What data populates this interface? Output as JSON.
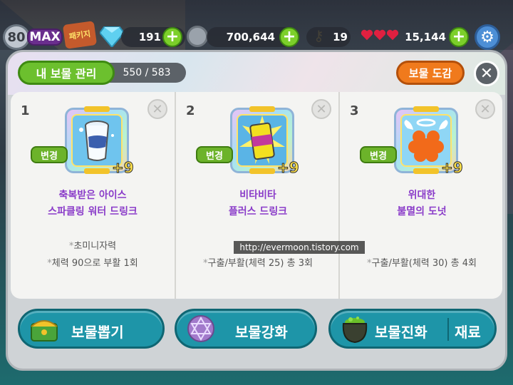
{
  "top_bar": {
    "level": "80",
    "max_label": "MAX",
    "event_label": "패키지",
    "gems": "191",
    "coins": "700,644",
    "keys": "19",
    "hearts": "15,144"
  },
  "panel": {
    "tab_label": "내 보물 관리",
    "count": "550 / 583",
    "dex_button": "보물 도감"
  },
  "slots": [
    {
      "number": "1",
      "change_label": "변경",
      "enhance": "+9",
      "name_line1": "축복받은 아이스",
      "name_line2": "스파클링 워터 드링크",
      "desc_line1": "초미니자력",
      "desc_line2": "체력 90으로 부활 1회",
      "icon": "ice-sparkling-water-can-icon"
    },
    {
      "number": "2",
      "change_label": "변경",
      "enhance": "+9",
      "name_line1": "비타비타",
      "name_line2": "플러스 드링크",
      "desc_line1": "",
      "desc_line2": "구출/부활(체력 25) 총 3회",
      "icon": "vita-plus-drink-can-icon"
    },
    {
      "number": "3",
      "change_label": "변경",
      "enhance": "+9",
      "name_line1": "위대한",
      "name_line2": "불멸의 도넛",
      "desc_line1": "",
      "desc_line2": "구출/부활(체력 30) 총 4회",
      "icon": "immortal-donut-icon"
    }
  ],
  "bottom": {
    "draw_label": "보물뽑기",
    "enhance_label": "보물강화",
    "evolve_label": "보물진화",
    "material_label": "재료"
  },
  "watermark": "http://evermoon.tistory.com",
  "colors": {
    "accent_green": "#6cc02e",
    "accent_orange": "#f07a1c",
    "item_name_purple": "#8a3cc9",
    "bottom_teal": "#1e95a8"
  }
}
